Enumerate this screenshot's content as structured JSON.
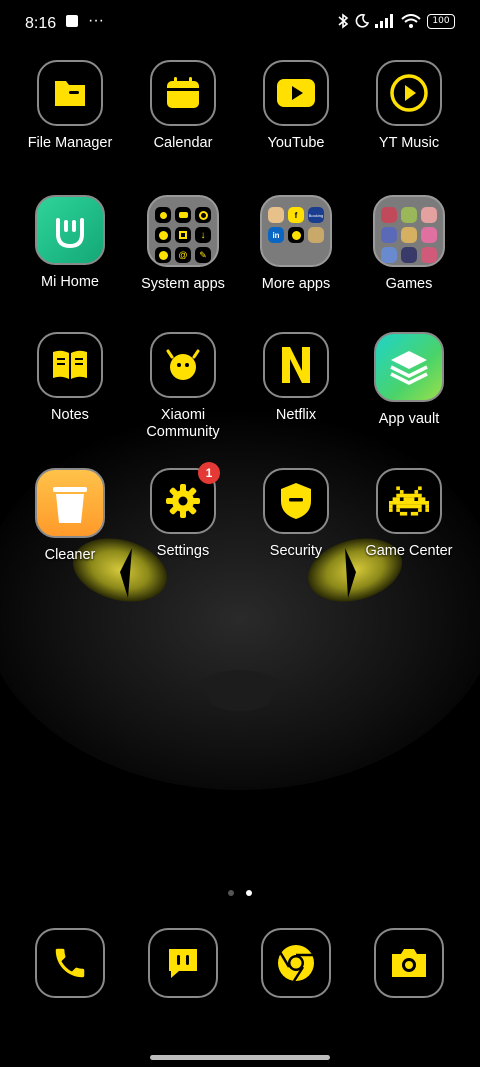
{
  "status_bar": {
    "time": "8:16",
    "battery": "100",
    "icons": [
      "notification-square-icon",
      "more-dots-icon",
      "bluetooth-icon",
      "moon-icon",
      "signal-icon",
      "wifi-icon",
      "battery-icon"
    ]
  },
  "colors": {
    "accent": "#FFE000",
    "frame": "#8a8a8a",
    "badge": "#e53935"
  },
  "apps": {
    "file_manager": "File Manager",
    "calendar": "Calendar",
    "youtube": "YouTube",
    "yt_music": "YT Music",
    "mi_home": "Mi Home",
    "system_apps": "System apps",
    "more_apps": "More apps",
    "games": "Games",
    "notes": "Notes",
    "xiaomi_community_line1": "Xiaomi",
    "xiaomi_community_line2": "Community",
    "netflix": "Netflix",
    "app_vault": "App vault",
    "cleaner": "Cleaner",
    "settings": "Settings",
    "settings_badge": "1",
    "security": "Security",
    "game_center": "Game Center"
  },
  "more_apps_folder": {
    "booking_text": "Booking"
  },
  "pages": {
    "count": 2,
    "current": 2
  },
  "dock": [
    "phone-icon",
    "messages-icon",
    "chrome-icon",
    "camera-icon"
  ]
}
